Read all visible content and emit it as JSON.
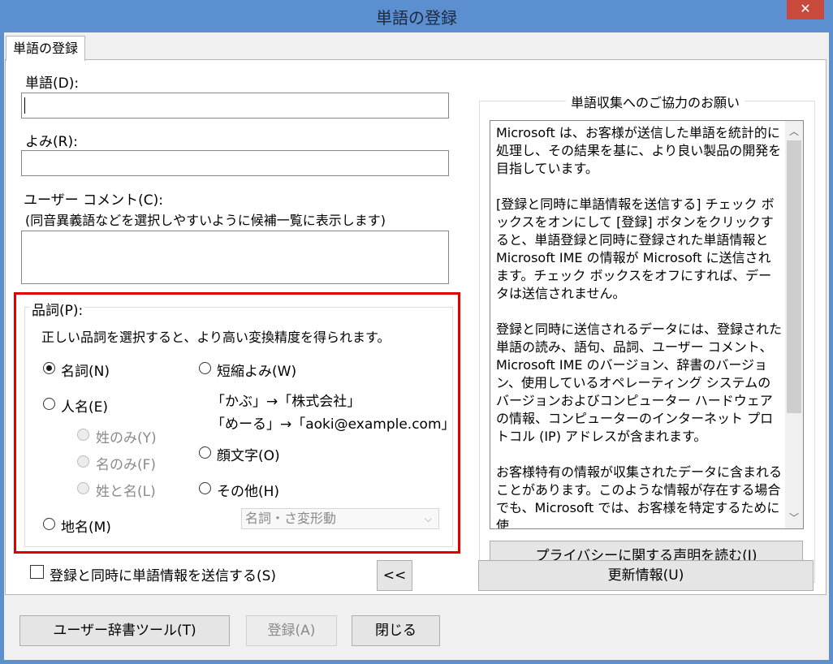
{
  "window": {
    "title": "単語の登録",
    "close_glyph": "✕"
  },
  "tab": {
    "label": "単語の登録"
  },
  "word": {
    "label": "単語(D):",
    "value": ""
  },
  "reading": {
    "label": "よみ(R):",
    "value": ""
  },
  "comment": {
    "label": "ユーザー コメント(C):",
    "hint": "(同音異義語などを選択しやすいように候補一覧に表示します)",
    "value": ""
  },
  "pos": {
    "label": "品詞(P):",
    "description": "正しい品詞を選択すると、より高い変換精度を得られます。",
    "noun": "名詞(N)",
    "person": "人名(E)",
    "surname_only": "姓のみ(Y)",
    "given_only": "名のみ(F)",
    "full_name": "姓と名(L)",
    "place": "地名(M)",
    "abbrev": "短縮よみ(W)",
    "abbrev_example1": "「かぶ」→「株式会社」",
    "abbrev_example2": "「めーる」→「aoki@example.com」",
    "emoticon": "顔文字(O)",
    "other": "その他(H)",
    "subtype_select": "名詞・さ変形動",
    "selected": "noun"
  },
  "send_checkbox": {
    "label": "登録と同時に単語情報を送信する(S)",
    "checked": false
  },
  "collapse_button": "<<",
  "info": {
    "title": "単語収集へのご協力のお願い",
    "paragraphs": [
      "Microsoft は、お客様が送信した単語を統計的に処理し、その結果を基に、より良い製品の開発を目指しています。",
      "[登録と同時に単語情報を送信する] チェック ボックスをオンにして [登録] ボタンをクリックすると、単語登録と同時に登録された単語情報と Microsoft IME の情報が Microsoft に送信されます。チェック ボックスをオフにすれば、データは送信されません。",
      "登録と同時に送信されるデータには、登録された単語の読み、語句、品詞、ユーザー コメント、Microsoft IME のバージョン、辞書のバージョン、使用しているオペレーティング システムのバージョンおよびコンピューター ハードウェアの情報、コンピューターのインターネット プロトコル (IP) アドレスが含まれます。",
      "お客様特有の情報が収集されたデータに含まれることがあります。このような情報が存在する場合でも、Microsoft では、お客様を特定するために使"
    ],
    "privacy_button": "プライバシーに関する声明を読む(I)",
    "update_button": "更新情報(U)"
  },
  "footer": {
    "dictionary_tool": "ユーザー辞書ツール(T)",
    "register": "登録(A)",
    "close": "閉じる"
  }
}
